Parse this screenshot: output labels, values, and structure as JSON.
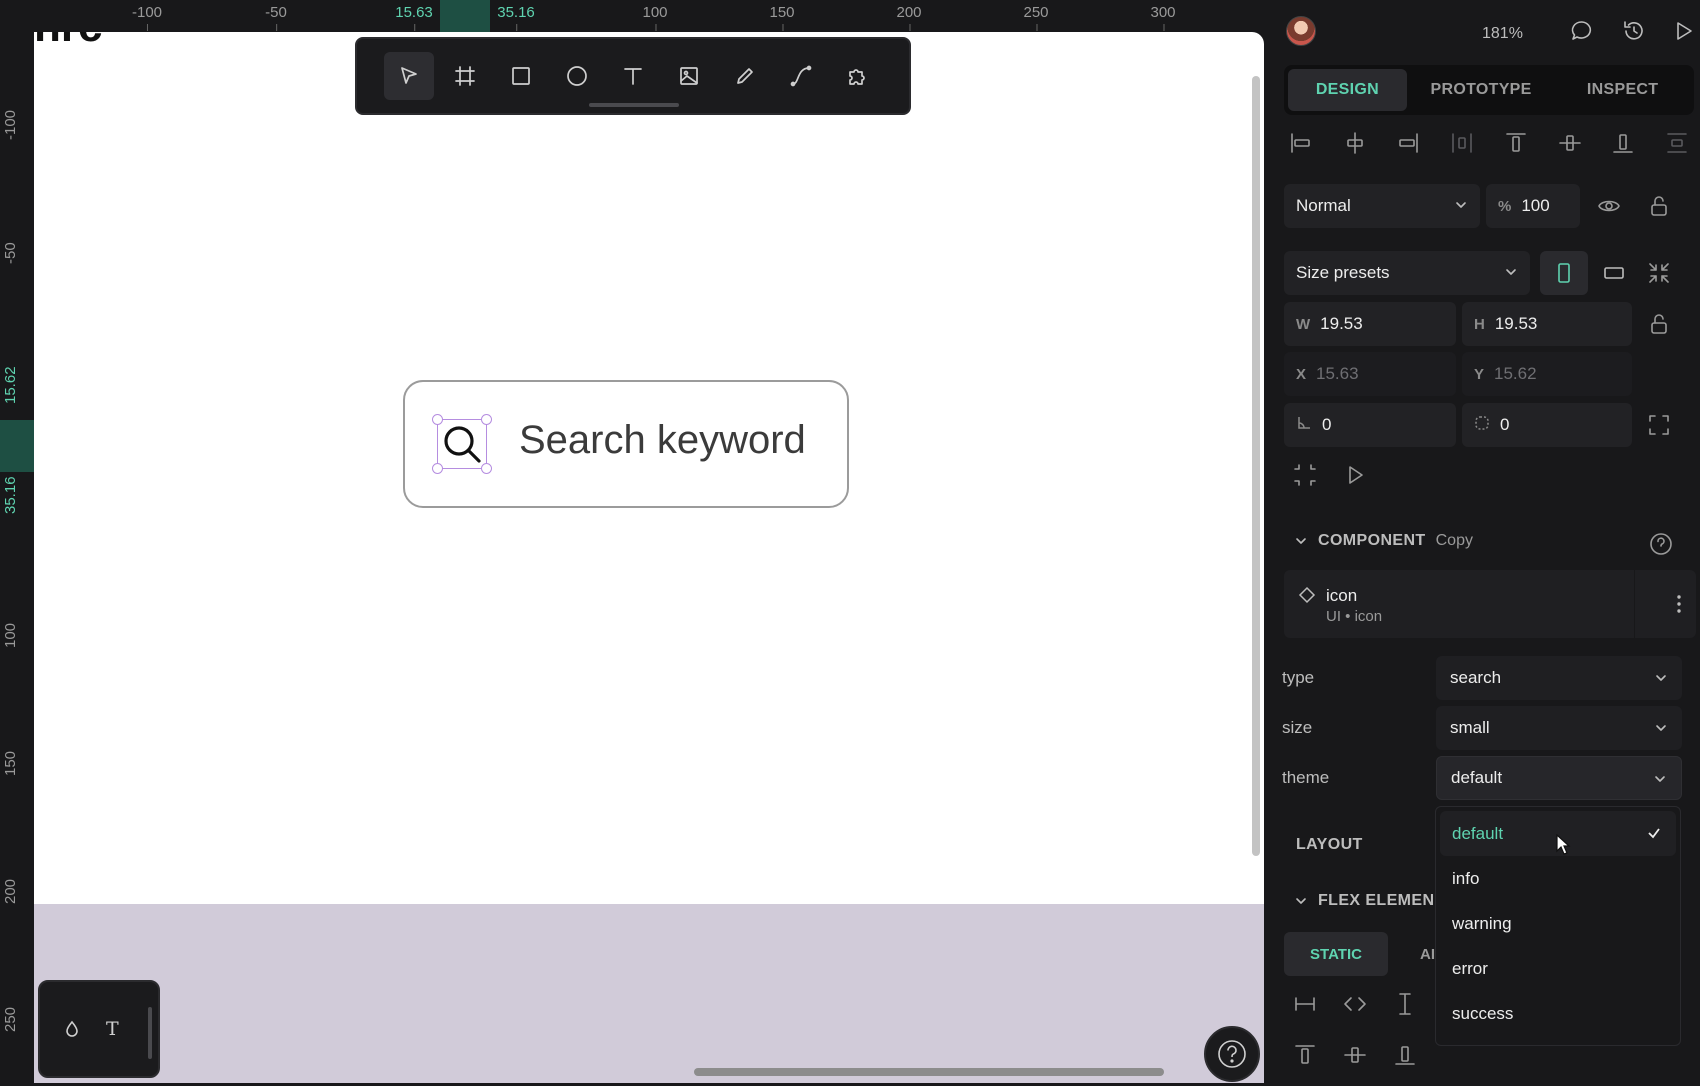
{
  "rulers": {
    "top_ticks": [
      "-100",
      "-50",
      "15.63",
      "35.16",
      "100",
      "150",
      "200",
      "250",
      "300"
    ],
    "left_ticks": [
      "-100",
      "-50",
      "15.62",
      "35.16",
      "100",
      "150",
      "200",
      "250"
    ]
  },
  "canvas": {
    "top_fragment": "nrc",
    "search_placeholder": "Search keyword"
  },
  "toolbar": {
    "tools": [
      "move-tool",
      "board-tool",
      "rectangle-tool",
      "ellipse-tool",
      "text-tool",
      "image-tool",
      "pencil-tool",
      "path-tool",
      "plugins-tool"
    ],
    "active": "move-tool"
  },
  "mini_bar": {
    "text_label": "T"
  },
  "header": {
    "zoom": "181%"
  },
  "tabs": {
    "design": "DESIGN",
    "prototype": "PROTOTYPE",
    "inspect": "INSPECT"
  },
  "layer": {
    "blend_mode": "Normal",
    "opacity_label": "%",
    "opacity_value": "100"
  },
  "measures": {
    "size_presets": "Size presets",
    "w_label": "W",
    "w_value": "19.53",
    "h_label": "H",
    "h_value": "19.53",
    "x_label": "X",
    "x_value": "15.63",
    "y_label": "Y",
    "y_value": "15.62",
    "rotation_value": "0",
    "radius_value": "0"
  },
  "component": {
    "section_title": "COMPONENT",
    "section_sub": "Copy",
    "name": "icon",
    "path": "UI • icon"
  },
  "props": {
    "type_label": "type",
    "type_value": "search",
    "size_label": "size",
    "size_value": "small",
    "theme_label": "theme",
    "theme_value": "default"
  },
  "dropdown": {
    "options": [
      "default",
      "info",
      "warning",
      "error",
      "success"
    ],
    "selected": "default"
  },
  "layout": {
    "layout_title": "LAYOUT",
    "flex_title": "FLEX ELEMEN",
    "static_tab": "STATIC",
    "absolute_tab_partial": "AI"
  },
  "colors": {
    "accent": "#5fd3b0",
    "panel_bg": "#18181a",
    "selection": "#b58de0",
    "canvas_lower": "#d1cbd9"
  }
}
